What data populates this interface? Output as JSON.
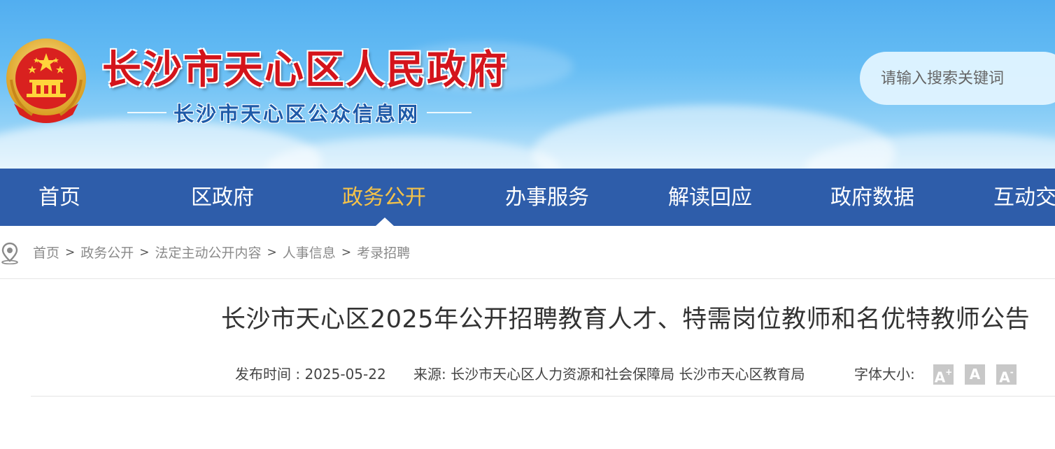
{
  "header": {
    "site_title": "长沙市天心区人民政府",
    "subtitle": "长沙市天心区公众信息网",
    "search_placeholder": "请输入搜索关键词"
  },
  "nav": {
    "items": [
      {
        "label": "首页",
        "active": false
      },
      {
        "label": "区政府",
        "active": false
      },
      {
        "label": "政务公开",
        "active": true
      },
      {
        "label": "办事服务",
        "active": false
      },
      {
        "label": "解读回应",
        "active": false
      },
      {
        "label": "政府数据",
        "active": false
      },
      {
        "label": "互动交"
      }
    ]
  },
  "breadcrumb": {
    "items": [
      "首页",
      "政务公开",
      "法定主动公开内容",
      "人事信息",
      "考录招聘"
    ],
    "separator": ">"
  },
  "article": {
    "title": "长沙市天心区2025年公开招聘教育人才、特需岗位教师和名优特教师公告",
    "publish_time": "发布时间 : 2025-05-22",
    "source": "来源:  长沙市天心区人力资源和社会保障局 长沙市天心区教育局",
    "font_size_label": "字体大小:",
    "font_buttons": [
      "A+",
      "A",
      "A-"
    ]
  },
  "colors": {
    "nav_bg": "#2e5daa",
    "nav_active": "#f4c24a",
    "title_red": "#d4141b",
    "subtitle_blue": "#1e5aa8"
  }
}
